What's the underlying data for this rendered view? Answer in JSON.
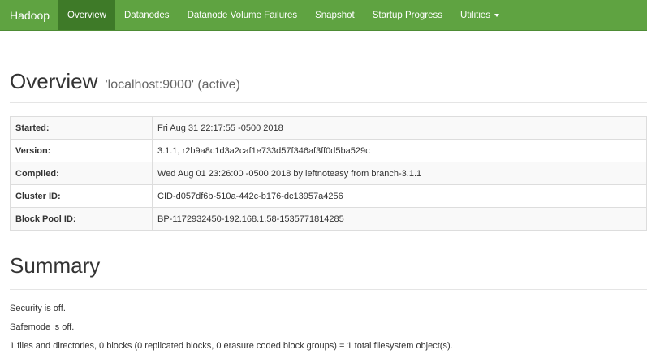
{
  "navbar": {
    "brand": "Hadoop",
    "items": [
      {
        "label": "Overview",
        "active": true
      },
      {
        "label": "Datanodes"
      },
      {
        "label": "Datanode Volume Failures"
      },
      {
        "label": "Snapshot"
      },
      {
        "label": "Startup Progress"
      },
      {
        "label": "Utilities"
      }
    ]
  },
  "overview": {
    "title": "Overview",
    "subtitle": "'localhost:9000' (active)",
    "rows": [
      {
        "label": "Started:",
        "value": "Fri Aug 31 22:17:55 -0500 2018"
      },
      {
        "label": "Version:",
        "value": "3.1.1, r2b9a8c1d3a2caf1e733d57f346af3ff0d5ba529c"
      },
      {
        "label": "Compiled:",
        "value": "Wed Aug 01 23:26:00 -0500 2018 by leftnoteasy from branch-3.1.1"
      },
      {
        "label": "Cluster ID:",
        "value": "CID-d057df6b-510a-442c-b176-dc13957a4256"
      },
      {
        "label": "Block Pool ID:",
        "value": "BP-1172932450-192.168.1.58-1535771814285"
      }
    ]
  },
  "summary": {
    "title": "Summary",
    "security": "Security is off.",
    "safemode": "Safemode is off.",
    "files": "1 files and directories, 0 blocks (0 replicated blocks, 0 erasure coded block groups) = 1 total filesystem object(s)."
  },
  "colors": {
    "navbar": "#5fa341",
    "navbar_active": "#3e7a28"
  }
}
